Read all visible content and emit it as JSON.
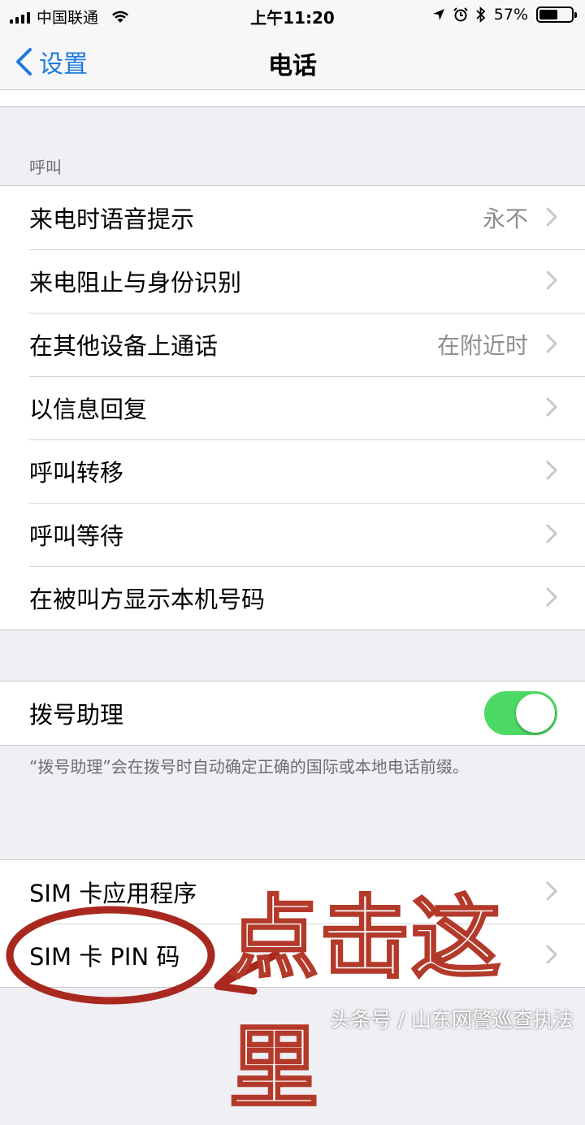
{
  "status_bar": {
    "carrier": "中国联通",
    "time": "上午11:20",
    "battery_percent": "57%",
    "battery_level": 0.57
  },
  "nav": {
    "back_label": "设置",
    "title": "电话"
  },
  "sections": {
    "calls_header": "呼叫",
    "calls_rows": [
      {
        "label": "来电时语音提示",
        "value": "永不"
      },
      {
        "label": "来电阻止与身份识别",
        "value": ""
      },
      {
        "label": "在其他设备上通话",
        "value": "在附近时"
      },
      {
        "label": "以信息回复",
        "value": ""
      },
      {
        "label": "呼叫转移",
        "value": ""
      },
      {
        "label": "呼叫等待",
        "value": ""
      },
      {
        "label": "在被叫方显示本机号码",
        "value": ""
      }
    ],
    "dial_assist": {
      "label": "拨号助理",
      "enabled": true,
      "footnote": "“拨号助理”会在拨号时自动确定正确的国际或本地电话前缀。"
    },
    "sim_rows": [
      {
        "label": "SIM 卡应用程序"
      },
      {
        "label": "SIM 卡 PIN 码"
      }
    ]
  },
  "annotation": {
    "text": "点击这里",
    "color": "#b33a2a"
  },
  "watermark": "头条号 / 山东网警巡查执法",
  "colors": {
    "accent": "#1f7ae0",
    "toggle_on": "#4cd964",
    "background": "#efeff4"
  }
}
